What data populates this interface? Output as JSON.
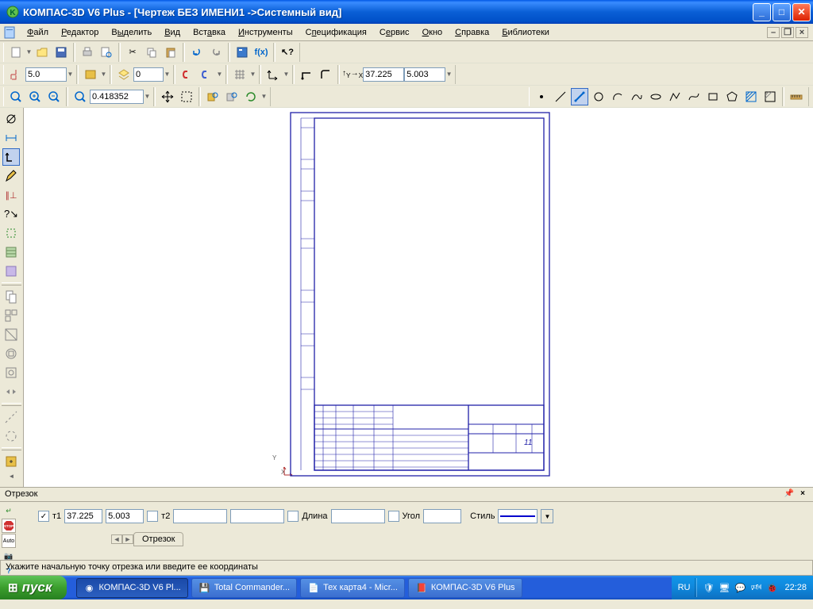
{
  "window": {
    "title": "КОМПАС-3D V6 Plus - [Чертеж БЕЗ ИМЕНИ1 ->Системный вид]"
  },
  "menu": {
    "file": "Файл",
    "editor": "Редактор",
    "select": "Выделить",
    "view": "Вид",
    "insert": "Вставка",
    "tools": "Инструменты",
    "spec": "Спецификация",
    "service": "Сервис",
    "window": "Окно",
    "help": "Справка",
    "libs": "Библиотеки"
  },
  "toolbar2": {
    "step_value": "5.0",
    "layer_value": "0",
    "coord_x_label": "x→",
    "coord_y_label": "↑y",
    "coord_x": "37.225",
    "coord_y": "5.003"
  },
  "toolbar3": {
    "zoom_value": "0.418352"
  },
  "drawing": {
    "origin_x_label": "X",
    "origin_y_label": "Y",
    "page_number": "11"
  },
  "property_panel": {
    "title": "Отрезок",
    "point1_label": "т1",
    "point1_x": "37.225",
    "point1_y": "5.003",
    "point2_label": "т2",
    "point2_x": "",
    "point2_y": "",
    "length_label": "Длина",
    "length_value": "",
    "angle_label": "Угол",
    "angle_value": "",
    "style_label": "Стиль",
    "tab_label": "Отрезок",
    "auto_label": "Auto",
    "stop_label": "STOP"
  },
  "statusbar": {
    "hint": "Укажите начальную точку отрезка или введите ее координаты"
  },
  "taskbar": {
    "start": "пуск",
    "task1": "КОМПАС-3D V6 Pl...",
    "task2": "Total Commander...",
    "task3": "Тех карта4 - Micr...",
    "task4": "КОМПАС-3D V6 Plus",
    "lang": "RU",
    "time": "22:28"
  }
}
